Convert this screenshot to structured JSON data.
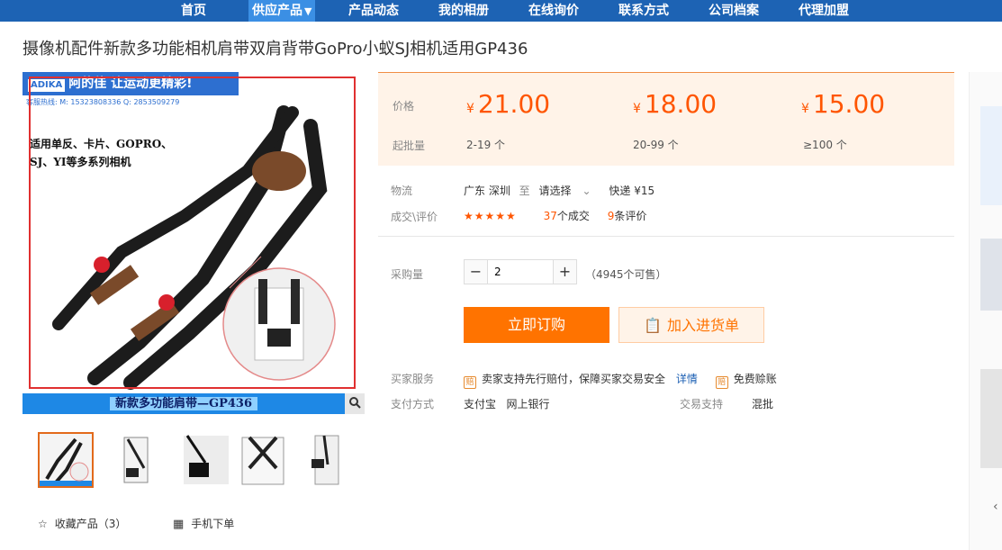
{
  "nav": {
    "items": [
      "首页",
      "供应产品",
      "产品动态",
      "我的相册",
      "在线询价",
      "联系方式",
      "公司档案",
      "代理加盟"
    ],
    "active_caret": "▼"
  },
  "title": "摄像机配件新款多功能相机肩带双肩背带GoPro小蚁SJ相机适用GP436",
  "image": {
    "banner_logo": "ADIKA",
    "banner_text": "阿的佳 让运动更精彩!",
    "hotline": "客服热线: M: 15323808336  Q: 2853509279",
    "compat_line1": "适用单反、卡片、GOPRO、",
    "compat_line2": "SJ、YI等多系列相机",
    "bottom_banner": "新款多功能肩带—GP436",
    "zoom_icon": "magnifier-icon"
  },
  "actions": {
    "collect": "收藏产品（3）",
    "mobile_order": "手机下单"
  },
  "price": {
    "price_label": "价格",
    "moq_label": "起批量",
    "currency": "¥",
    "tiers": [
      {
        "price": "21.00",
        "range": "2-19 个"
      },
      {
        "price": "18.00",
        "range": "20-99 个"
      },
      {
        "price": "15.00",
        "range": "≥100 个"
      }
    ]
  },
  "logistics": {
    "label": "物流",
    "from": "广东 深圳",
    "to_word": "至",
    "select": "请选择",
    "express": "快递 ¥15"
  },
  "deals": {
    "label": "成交\\评价",
    "stars": "★★★★★",
    "deal_count": "37",
    "deal_suffix": "个成交",
    "review_count": "9",
    "review_suffix": "条评价"
  },
  "purchase": {
    "label": "采购量",
    "minus": "−",
    "plus": "+",
    "quantity": "2",
    "available": "（4945个可售）",
    "buy_now": "立即订购",
    "add_to_list": "加入进货单"
  },
  "service": {
    "label": "买家服务",
    "badge1": "赔",
    "text": "卖家支持先行赔付，保障买家交易安全",
    "detail": "详情",
    "badge2": "赔",
    "free": "免费赊账"
  },
  "payment": {
    "label": "支付方式",
    "methods": "支付宝   网上银行",
    "trade_label": "交易支持",
    "trade_value": "混批"
  },
  "colors": {
    "nav_bg": "#1d63b4",
    "accent": "#ff7300",
    "price": "#ff5500"
  }
}
